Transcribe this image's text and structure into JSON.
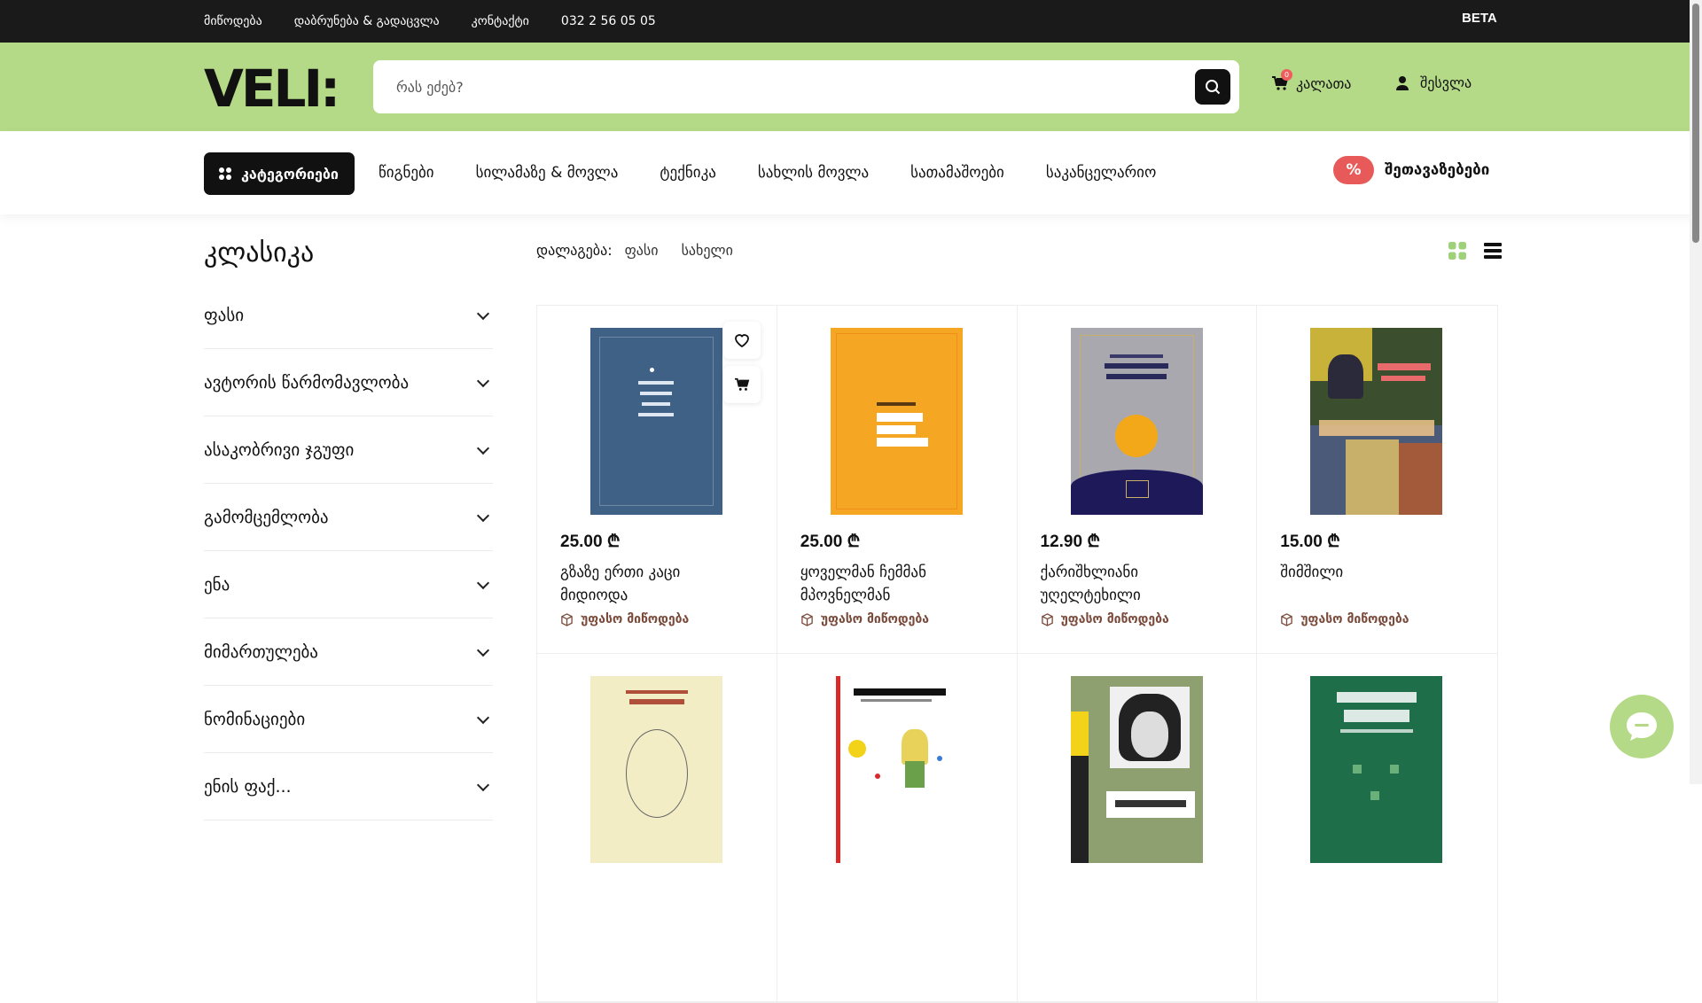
{
  "topbar": {
    "links": [
      "მიწოდება",
      "დაბრუნება & გადაცვლა",
      "კონტაქტი",
      "032 2 56 05 05"
    ],
    "beta": "BETA"
  },
  "header": {
    "logo": "VELI:",
    "search_placeholder": "რას ეძებ?",
    "cart_label": "კალათა",
    "cart_count": "0",
    "login_label": "შესვლა"
  },
  "nav": {
    "categories_label": "კატეგორიები",
    "links": [
      "წიგნები",
      "სილამაზე & მოვლა",
      "ტექნიკა",
      "სახლის მოვლა",
      "სათამაშოები",
      "საკანცელარიო"
    ],
    "promo_badge": "%",
    "promo_label": "შეთავაზებები"
  },
  "page": {
    "title": "კლასიკა",
    "sort_label": "დალაგება:",
    "sort_options": [
      "ფასი",
      "სახელი"
    ]
  },
  "filters": [
    "ფასი",
    "ავტორის წარმომავლობა",
    "ასაკობრივი ჯგუფი",
    "გამომცემლობა",
    "ენა",
    "მიმართულება",
    "ნომინაციები",
    "ენის ფაქ..."
  ],
  "products": [
    {
      "price": "25.00 ₾",
      "title": "გზაზე ერთი კაცი მიდიოდა",
      "shipping": "უფასო მიწოდება",
      "cover_color": "#3f6186"
    },
    {
      "price": "25.00 ₾",
      "title": "ყოველმან ჩემმან მპოვნელმან",
      "shipping": "უფასო მიწოდება",
      "cover_color": "#f5a623"
    },
    {
      "price": "12.90 ₾",
      "title": "ქარიშხლიანი უღელტეხილი",
      "shipping": "უფასო მიწოდება",
      "cover_color": "#a8a8ae"
    },
    {
      "price": "15.00 ₾",
      "title": "შიმშილი",
      "shipping": "უფასო მიწოდება",
      "cover_color": "#4a5a78"
    },
    {
      "price": "",
      "title": "",
      "shipping": "",
      "cover_color": "#f3edc5"
    },
    {
      "price": "",
      "title": "",
      "shipping": "",
      "cover_color": "#ffffff"
    },
    {
      "price": "",
      "title": "",
      "shipping": "",
      "cover_color": "#8fa070"
    },
    {
      "price": "",
      "title": "",
      "shipping": "",
      "cover_color": "#1e6e4a"
    }
  ],
  "colors": {
    "accent_green": "#b4da88",
    "dark": "#1a1a1a",
    "promo_red": "#e85a5a",
    "shipping_brown": "#7a4a3a"
  }
}
